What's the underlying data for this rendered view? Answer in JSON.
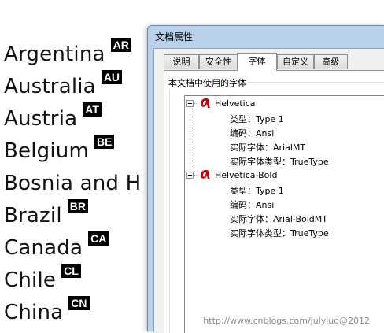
{
  "countries": [
    {
      "name": "Argentina",
      "code": "AR"
    },
    {
      "name": "Australia",
      "code": "AU"
    },
    {
      "name": "Austria",
      "code": "AT"
    },
    {
      "name": "Belgium",
      "code": "BE"
    },
    {
      "name": "Bosnia and H",
      "code": ""
    },
    {
      "name": "Brazil",
      "code": "BR"
    },
    {
      "name": "Canada",
      "code": "CA"
    },
    {
      "name": "Chile",
      "code": "CL"
    },
    {
      "name": "China",
      "code": "CN"
    }
  ],
  "dialog": {
    "title": "文档属性",
    "tabs": [
      {
        "label": "说明",
        "active": false
      },
      {
        "label": "安全性",
        "active": false
      },
      {
        "label": "字体",
        "active": true
      },
      {
        "label": "自定义",
        "active": false
      },
      {
        "label": "高级",
        "active": false
      }
    ],
    "group_label": "本文档中使用的字体",
    "fonts": [
      {
        "name": "Helvetica",
        "props": [
          "类型：Type 1",
          "编码：Ansi",
          "实际字体：ArialMT",
          "实际字体类型：TrueType"
        ]
      },
      {
        "name": "Helvetica-Bold",
        "props": [
          "类型：Type 1",
          "编码：Ansi",
          "实际字体：Arial-BoldMT",
          "实际字体类型：TrueType"
        ]
      }
    ],
    "icon_color": "#cc0000"
  },
  "watermark": "http://www.cnblogs.com/julyluo@2012"
}
